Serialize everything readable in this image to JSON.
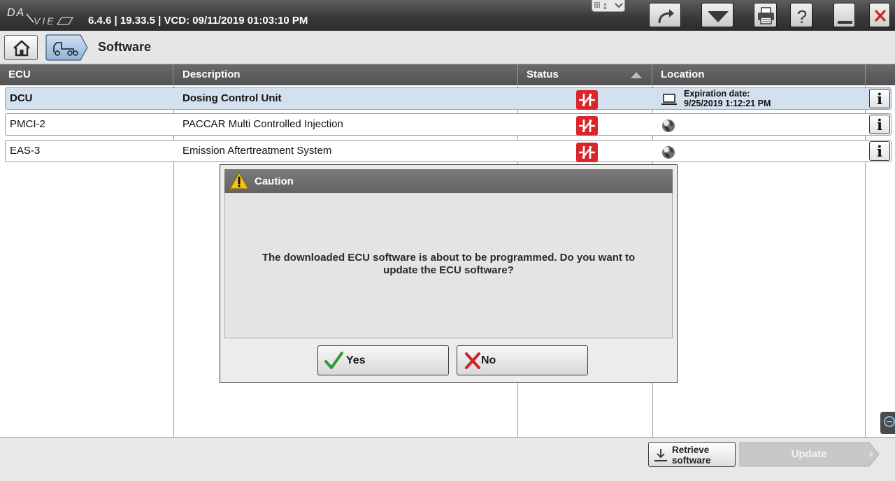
{
  "titlebar": {
    "logo_text": "DAVIE4",
    "version": "6.4.6 | 19.33.5 | VCD: 09/11/2019 01:03:10 PM",
    "buttons": [
      {
        "icon": "redo-arrow-icon"
      },
      {
        "icon": "dropdown-triangle-icon"
      },
      {
        "icon": "printer-icon"
      },
      {
        "icon": "help-icon"
      },
      {
        "icon": "minimize-icon"
      },
      {
        "icon": "close-icon"
      }
    ]
  },
  "breadcrumb": {
    "home_icon": "home-icon",
    "vehicle_icon": "vehicle-icon",
    "title": "Software"
  },
  "table": {
    "columns": [
      "ECU",
      "Description",
      "Status",
      "Location"
    ],
    "rows": [
      {
        "ecu": "DCU",
        "description": "Dosing Control Unit",
        "status_icon": "not-connected-icon",
        "location_icon": "laptop-icon",
        "location_line1": "Expiration date:",
        "location_line2": "9/25/2019 1:12:21 PM",
        "selected": true
      },
      {
        "ecu": "PMCI-2",
        "description": "PACCAR Multi Controlled Injection",
        "status_icon": "not-connected-icon",
        "location_icon": "globe-icon"
      },
      {
        "ecu": "EAS-3",
        "description": "Emission Aftertreatment System",
        "status_icon": "not-connected-icon",
        "location_icon": "globe-icon"
      }
    ],
    "info_label": "i"
  },
  "dialog": {
    "title": "Caution",
    "message_line1": "The downloaded ECU software is about to be programmed. Do you want to",
    "message_line2": "update the ECU software?",
    "yes_label": "Yes",
    "no_label": "No"
  },
  "footer": {
    "retrieve_line1": "Retrieve",
    "retrieve_line2": "software",
    "update_label": "Update"
  },
  "colors": {
    "status_red": "#d8262b",
    "header_gray": "#5c5c5c",
    "selected_row": "#d3e0ee",
    "yes_green": "#2e9a32",
    "no_red": "#c8252b"
  }
}
